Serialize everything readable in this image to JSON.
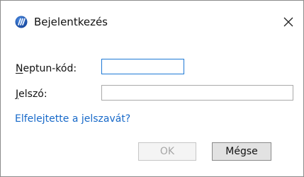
{
  "window": {
    "title": "Bejelentkezés",
    "app_icon": "neptun-app-icon",
    "close_icon": "close-icon"
  },
  "form": {
    "neptun_label_mnemonic": "N",
    "neptun_label_rest": "eptun-kód:",
    "neptun_value": "",
    "password_label_mnemonic": "J",
    "password_label_rest": "elszó:",
    "password_value": "",
    "forgot_link": "Elfelejtette a jelszavát?"
  },
  "buttons": {
    "ok_label": "OK",
    "ok_enabled": false,
    "cancel_label": "Mégse"
  },
  "colors": {
    "link": "#1769c9",
    "input_focus_border": "#1e79d6",
    "app_icon_blue": "#1f5fbf"
  }
}
